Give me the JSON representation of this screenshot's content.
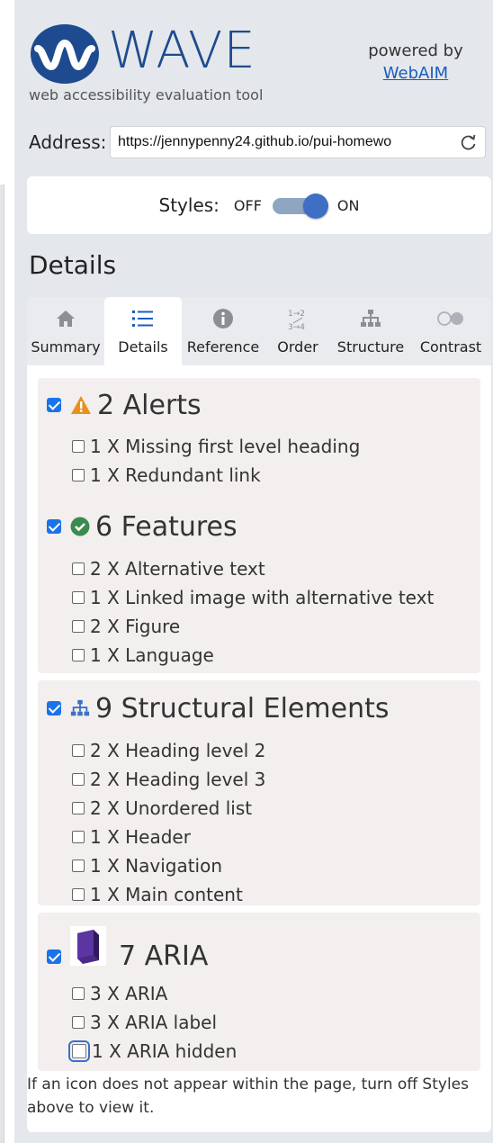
{
  "header": {
    "app_name": "WAVE",
    "tagline": "web accessibility evaluation tool",
    "powered_by": "powered by",
    "powered_link": "WebAIM"
  },
  "address": {
    "label": "Address:",
    "value": "https://jennypenny24.github.io/pui-homewo"
  },
  "styles": {
    "label": "Styles:",
    "off": "OFF",
    "on": "ON",
    "state": "on"
  },
  "details_title": "Details",
  "tabs": [
    {
      "label": "Summary",
      "icon": "home-icon"
    },
    {
      "label": "Details",
      "icon": "list-icon",
      "active": true
    },
    {
      "label": "Reference",
      "icon": "info-icon"
    },
    {
      "label": "Order",
      "icon": "order-icon"
    },
    {
      "label": "Structure",
      "icon": "structure-icon"
    },
    {
      "label": "Contrast",
      "icon": "contrast-icon"
    }
  ],
  "groups": [
    {
      "title": "2 Alerts",
      "icon": "warning-icon",
      "items": [
        "1 X Missing first level heading",
        "1 X Redundant link"
      ]
    },
    {
      "title": "6 Features",
      "icon": "check-circle-icon",
      "items": [
        "2 X Alternative text",
        "1 X Linked image with alternative text",
        "2 X Figure",
        "1 X Language"
      ]
    },
    {
      "title": "9 Structural Elements",
      "icon": "structure-icon",
      "items": [
        "2 X Heading level 2",
        "2 X Heading level 3",
        "2 X Unordered list",
        "1 X Header",
        "1 X Navigation",
        "1 X Main content"
      ]
    },
    {
      "title": "7 ARIA",
      "icon": "aria-cube-icon",
      "items": [
        "3 X ARIA",
        "3 X ARIA label",
        "1 X ARIA hidden"
      ]
    }
  ],
  "footer_note": "If an icon does not appear within the page, turn off Styles above to view it.",
  "colors": {
    "panel_bg": "#e4e7eb",
    "brand_blue": "#1e4b8f",
    "link_blue": "#1a5dbf",
    "alert_orange": "#e8901c",
    "feature_green": "#3b8a4e",
    "structure_blue": "#3e6fc4",
    "aria_purple": "#4b2a86"
  }
}
